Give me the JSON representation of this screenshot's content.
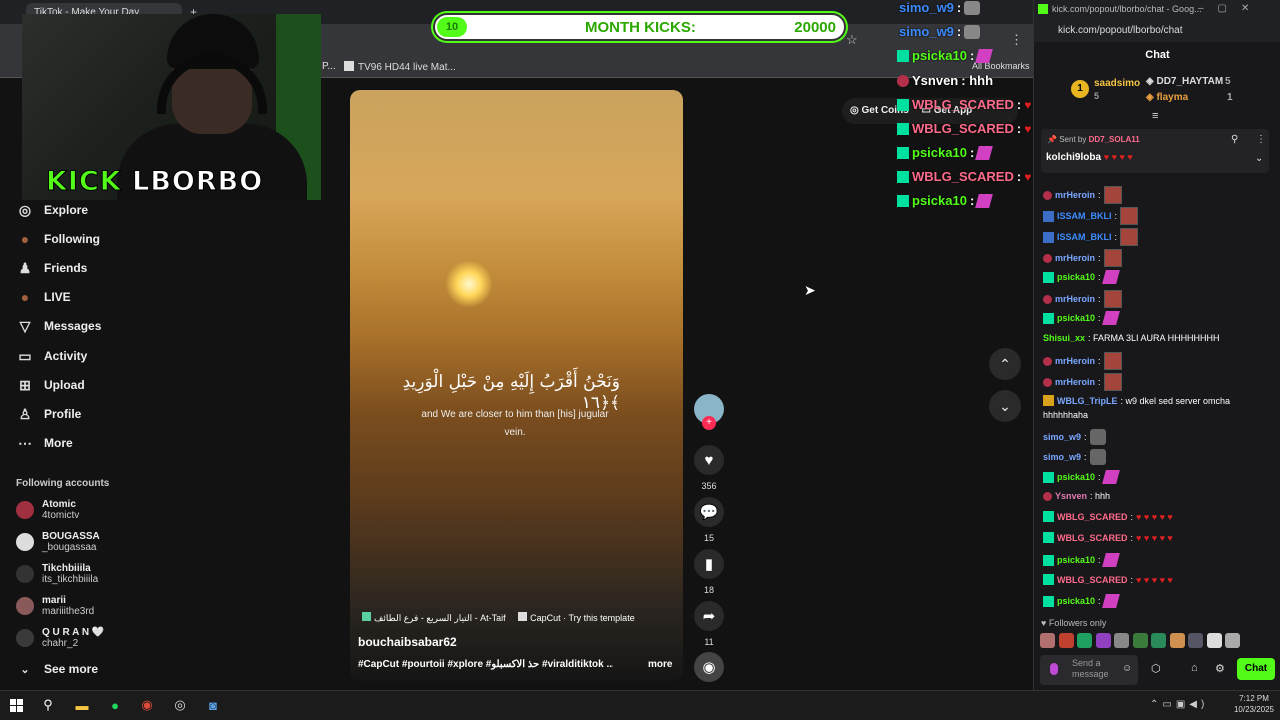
{
  "browser": {
    "tab_title": "TikTok - Make Your Day",
    "bookmarks": [
      "P...",
      "TV96 HD44 live Mat...",
      "All Bookmarks"
    ]
  },
  "stream_overlay": {
    "streamer_brand": "KICK",
    "streamer_name": "LBORBO",
    "kicks_current": "10",
    "kicks_label": "MONTH KICKS:",
    "kicks_goal": "20000",
    "kicks_progress_fraction": 0.0005
  },
  "tiktok": {
    "get_coins": "Get Coins",
    "get_app": "Get App",
    "nav": [
      {
        "label": "Explore",
        "icon": "compass-icon"
      },
      {
        "label": "Following",
        "icon": "avatar-icon"
      },
      {
        "label": "Friends",
        "icon": "friends-icon"
      },
      {
        "label": "LIVE",
        "icon": "live-icon"
      },
      {
        "label": "Messages",
        "icon": "messages-icon"
      },
      {
        "label": "Activity",
        "icon": "activity-icon"
      },
      {
        "label": "Upload",
        "icon": "upload-icon"
      },
      {
        "label": "Profile",
        "icon": "profile-icon"
      },
      {
        "label": "More",
        "icon": "more-icon"
      }
    ],
    "following_header": "Following accounts",
    "accounts": [
      {
        "name": "Atomic",
        "handle": "4tomictv"
      },
      {
        "name": "BOUGASSA",
        "handle": "_bougassaa"
      },
      {
        "name": "Tikchbiiila",
        "handle": "its_tikchbiiila"
      },
      {
        "name": "marii",
        "handle": "mariiithe3rd"
      },
      {
        "name": "Q U R A N 🤍",
        "handle": "chahr_2"
      }
    ],
    "see_more": "See more",
    "video": {
      "arabic_text": "وَنَحْنُ أَقْرَبُ إِلَيْهِ مِنْ حَبْلِ الْوَرِيدِ ﴿١٦﴾",
      "translation": "and We are closer to him than [his] jugular vein.",
      "music": "التيار السريع - فرع الطائف - At-Taif",
      "capcut": "CapCut · Try this template",
      "author": "bouchaibsabar62",
      "tags": "#CapCut #pourtoii #xplore #حذ الاكسبلو #viralditiktok ...",
      "more": "more",
      "likes": "356",
      "comments": "15",
      "saves": "18",
      "shares": "11"
    }
  },
  "overlay_chat": [
    {
      "user": "simo_w9",
      "color": "#3c8cff",
      "badge": "none",
      "text": ":"
    },
    {
      "user": "simo_w9",
      "color": "#3c8cff",
      "badge": "none",
      "text": ":"
    },
    {
      "user": "psicka10",
      "color": "#53fc18",
      "badge": "green",
      "text": ":"
    },
    {
      "user": "Ysnven",
      "color": "#ffffff",
      "badge": "red",
      "text": ": hhh"
    },
    {
      "user": "WBLG_SCARED",
      "color": "#ff6b8a",
      "badge": "green",
      "text": ":"
    },
    {
      "user": "WBLG_SCARED",
      "color": "#ff6b8a",
      "badge": "green",
      "text": ":"
    },
    {
      "user": "psicka10",
      "color": "#53fc18",
      "badge": "green",
      "text": ":"
    },
    {
      "user": "WBLG_SCARED",
      "color": "#ff6b8a",
      "badge": "green",
      "text": ":"
    },
    {
      "user": "psicka10",
      "color": "#53fc18",
      "badge": "green",
      "text": ":"
    }
  ],
  "kick_chat": {
    "window_title": "kick.com/popout/lborbo/chat - Goog...",
    "url": "kick.com/popout/lborbo/chat",
    "header": "Chat",
    "leaderboard": [
      {
        "rank": "1",
        "user": "saadsimo",
        "value": "5"
      },
      {
        "user": "DD7_HAYTAM",
        "value": "5"
      },
      {
        "user": "flayma",
        "value": "1"
      }
    ],
    "pinned_sent_by": "Sent by",
    "pinned_user": "DD7_SOLA11",
    "pinned_message": "kolchi9loba",
    "messages": [
      {
        "user": "mrHeroin",
        "color": "#7aa7ff",
        "badge": "red",
        "text": ":"
      },
      {
        "user": "ISSAM_BKLI",
        "color": "#3c8cff",
        "badge": "blue",
        "text": ":"
      },
      {
        "user": "ISSAM_BKLI",
        "color": "#3c8cff",
        "badge": "blue",
        "text": ":"
      },
      {
        "user": "mrHeroin",
        "color": "#7aa7ff",
        "badge": "red",
        "text": ":"
      },
      {
        "user": "psicka10",
        "color": "#53fc18",
        "badge": "green",
        "text": ":"
      },
      {
        "user": "mrHeroin",
        "color": "#7aa7ff",
        "badge": "red",
        "text": ":"
      },
      {
        "user": "psicka10",
        "color": "#53fc18",
        "badge": "green",
        "text": ":"
      },
      {
        "user": "Shisui_xx",
        "color": "#53fc18",
        "badge": "none",
        "text": ": FARMA 3LI AURA HHHHHHHH"
      },
      {
        "user": "mrHeroin",
        "color": "#7aa7ff",
        "badge": "red",
        "text": ":"
      },
      {
        "user": "mrHeroin",
        "color": "#7aa7ff",
        "badge": "red",
        "text": ":"
      },
      {
        "user": "WBLG_TripLE",
        "color": "#7aa7ff",
        "badge": "gold",
        "text": ": w9 dkel sed server omcha"
      },
      {
        "user": "",
        "color": "#ffffff",
        "badge": "none",
        "text": "hhhhhhaha"
      },
      {
        "user": "simo_w9",
        "color": "#7aa7ff",
        "badge": "none",
        "text": ":"
      },
      {
        "user": "simo_w9",
        "color": "#7aa7ff",
        "badge": "none",
        "text": ":"
      },
      {
        "user": "psicka10",
        "color": "#53fc18",
        "badge": "green",
        "text": ":"
      },
      {
        "user": "Ysnven",
        "color": "#e07ab0",
        "badge": "red",
        "text": ": hhh"
      },
      {
        "user": "WBLG_SCARED",
        "color": "#ff6b8a",
        "badge": "green",
        "text": ":"
      },
      {
        "user": "WBLG_SCARED",
        "color": "#ff6b8a",
        "badge": "green",
        "text": ":"
      },
      {
        "user": "psicka10",
        "color": "#53fc18",
        "badge": "green",
        "text": ":"
      },
      {
        "user": "WBLG_SCARED",
        "color": "#ff6b8a",
        "badge": "green",
        "text": ":"
      },
      {
        "user": "psicka10",
        "color": "#53fc18",
        "badge": "green",
        "text": ":"
      }
    ],
    "followers_only": "Followers only",
    "input_placeholder": "Send a message",
    "chat_button": "Chat"
  },
  "taskbar": {
    "time": "7:12 PM",
    "date": "10/23/2025"
  }
}
